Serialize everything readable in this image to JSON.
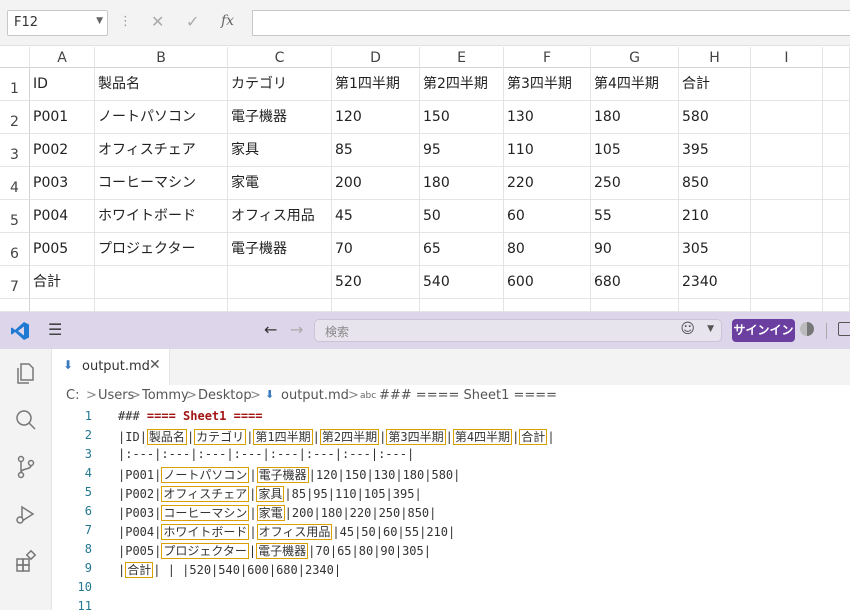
{
  "excel": {
    "namebox": "F12",
    "columns": [
      "A",
      "B",
      "C",
      "D",
      "E",
      "F",
      "G",
      "H",
      "I"
    ],
    "rows": [
      [
        "ID",
        "製品名",
        "カテゴリ",
        "第1四半期",
        "第2四半期",
        "第3四半期",
        "第4四半期",
        "合計",
        ""
      ],
      [
        "P001",
        "ノートパソコン",
        "電子機器",
        "120",
        "150",
        "130",
        "180",
        "580",
        ""
      ],
      [
        "P002",
        "オフィスチェア",
        "家具",
        "85",
        "95",
        "110",
        "105",
        "395",
        ""
      ],
      [
        "P003",
        "コーヒーマシン",
        "家電",
        "200",
        "180",
        "220",
        "250",
        "850",
        ""
      ],
      [
        "P004",
        "ホワイトボード",
        "オフィス用品",
        "45",
        "50",
        "60",
        "55",
        "210",
        ""
      ],
      [
        "P005",
        "プロジェクター",
        "電子機器",
        "70",
        "65",
        "80",
        "90",
        "305",
        ""
      ],
      [
        "合計",
        "",
        "",
        "520",
        "540",
        "600",
        "680",
        "2340",
        ""
      ]
    ],
    "row_numbers": [
      "1",
      "2",
      "3",
      "4",
      "5",
      "6",
      "7"
    ]
  },
  "vscode": {
    "search_placeholder": "検索",
    "signin_label": "サインイン",
    "tab_label": "output.md",
    "breadcrumb": [
      "C:",
      "Users",
      "Tommy",
      "Desktop",
      "output.md",
      "### ==== Sheet1 ===="
    ],
    "line_numbers": [
      "1",
      "2",
      "3",
      "4",
      "5",
      "6",
      "7",
      "8",
      "9",
      "10",
      "11"
    ],
    "heading_line": "### ==== Sheet1 ====",
    "separator_line": "|:---|:---|:---|:---|:---|:---|:---|:---|",
    "header_cells": [
      "ID",
      "製品名",
      "カテゴリ",
      "第1四半期",
      "第2四半期",
      "第3四半期",
      "第4四半期",
      "合計"
    ],
    "data_lines": [
      {
        "id": "P001",
        "text": [
          "ノートパソコン",
          "電子機器"
        ],
        "nums": "120|150|130|180|580|"
      },
      {
        "id": "P002",
        "text": [
          "オフィスチェア",
          "家具"
        ],
        "nums": "85|95|110|105|395|"
      },
      {
        "id": "P003",
        "text": [
          "コーヒーマシン",
          "家電"
        ],
        "nums": "200|180|220|250|850|"
      },
      {
        "id": "P004",
        "text": [
          "ホワイトボード",
          "オフィス用品"
        ],
        "nums": "45|50|60|55|210|"
      },
      {
        "id": "P005",
        "text": [
          "プロジェクター",
          "電子機器"
        ],
        "nums": "70|65|80|90|305|"
      }
    ],
    "total_line": {
      "label": "合計",
      "rest": "| | |520|540|600|680|2340|"
    }
  }
}
